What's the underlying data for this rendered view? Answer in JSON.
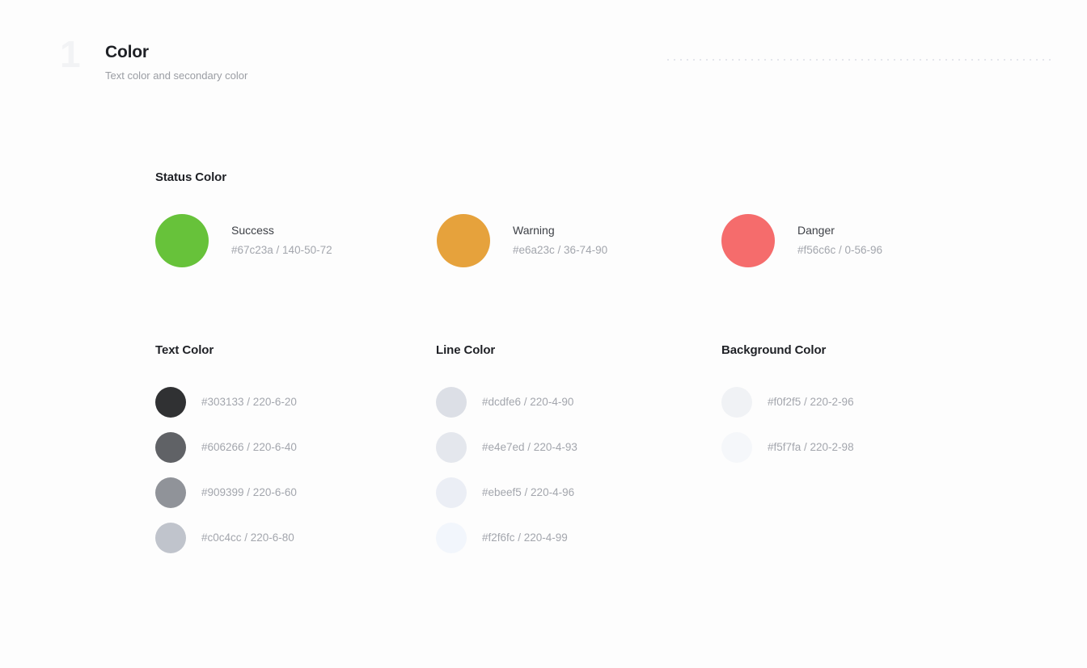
{
  "header": {
    "number": "1",
    "title": "Color",
    "subtitle": "Text color and secondary color",
    "decoration": "dot-grid"
  },
  "status_section": {
    "heading": "Status Color",
    "items": [
      {
        "name": "Success",
        "value": "#67c23a / 140-50-72",
        "hex": "#67c23a"
      },
      {
        "name": "Warning",
        "value": "#e6a23c / 36-74-90",
        "hex": "#e6a23c"
      },
      {
        "name": "Danger",
        "value": "#f56c6c / 0-56-96",
        "hex": "#f56c6c"
      }
    ]
  },
  "palette_columns": [
    {
      "heading": "Text Color",
      "items": [
        {
          "value": "#303133 / 220-6-20",
          "hex": "#303133"
        },
        {
          "value": "#606266 / 220-6-40",
          "hex": "#606266"
        },
        {
          "value": "#909399 / 220-6-60",
          "hex": "#909399"
        },
        {
          "value": "#c0c4cc / 220-6-80",
          "hex": "#c0c4cc"
        }
      ]
    },
    {
      "heading": "Line Color",
      "items": [
        {
          "value": "#dcdfe6 / 220-4-90",
          "hex": "#dcdfe6"
        },
        {
          "value": "#e4e7ed / 220-4-93",
          "hex": "#e4e7ed"
        },
        {
          "value": "#ebeef5 / 220-4-96",
          "hex": "#ebeef5"
        },
        {
          "value": "#f2f6fc / 220-4-99",
          "hex": "#f2f6fc"
        }
      ]
    },
    {
      "heading": "Background Color",
      "items": [
        {
          "value": "#f0f2f5 / 220-2-96",
          "hex": "#f0f2f5"
        },
        {
          "value": "#f5f7fa / 220-2-98",
          "hex": "#f5f7fa"
        }
      ]
    }
  ]
}
